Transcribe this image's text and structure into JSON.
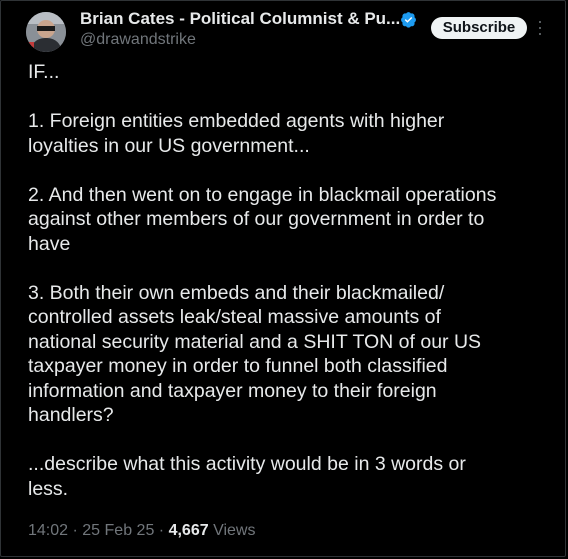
{
  "author": {
    "name": "Brian Cates - Political Columnist & Pu...",
    "handle": "@drawandstrike",
    "verified_color": "#1d9bf0"
  },
  "subscribe_label": "Subscribe",
  "tweet": {
    "lines": {
      "l1": "IF...",
      "l2": "1. Foreign entities embedded agents with higher",
      "l3": "loyalties in our US government...",
      "l4": "2. And then went on to engage in blackmail operations",
      "l5": "against other members of our government in order to",
      "l6": "have",
      "l7": "3. Both their own embeds and their blackmailed/",
      "l8": "controlled assets leak/steal massive amounts of",
      "l9": "national security material and a SHIT TON of our US",
      "l10": "taxpayer money in order to funnel both classified",
      "l11": "information and taxpayer money to their foreign",
      "l12": "handlers?",
      "l13": "...describe what this activity would be in 3 words or",
      "l14": "less."
    }
  },
  "meta": {
    "time": "14:02",
    "date": "25 Feb 25",
    "views_count": "4,667",
    "views_label": "Views",
    "separator": "·"
  }
}
